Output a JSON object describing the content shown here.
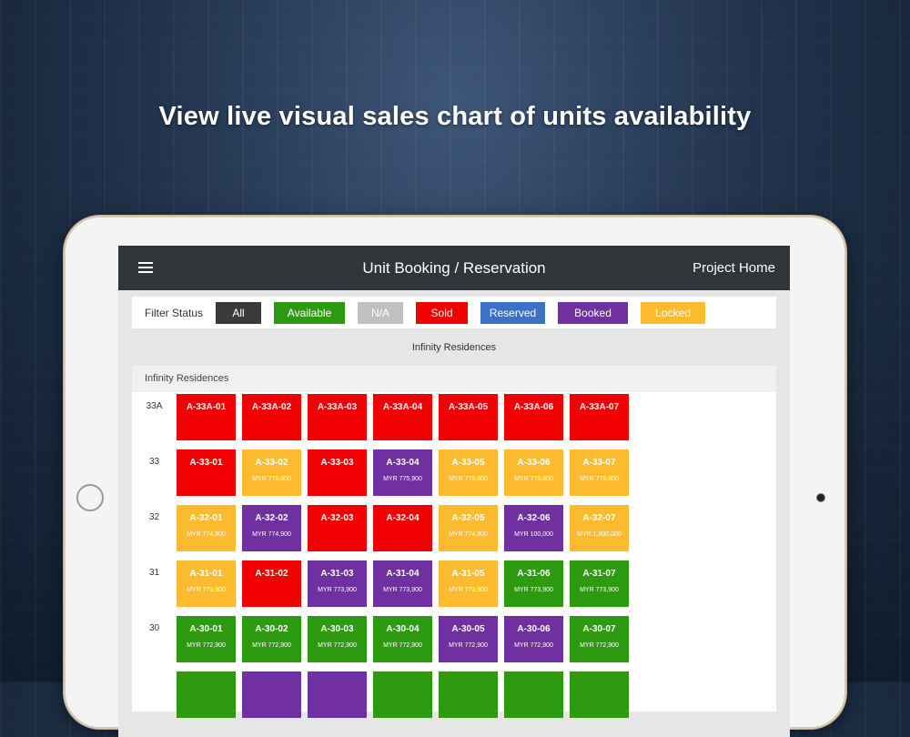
{
  "headline": "View live visual sales chart of units availability",
  "appbar": {
    "title": "Unit Booking / Reservation",
    "right_link": "Project Home"
  },
  "filter": {
    "label": "Filter Status",
    "chips": [
      {
        "label": "All",
        "color": "#3a3a3a",
        "width": 50
      },
      {
        "label": "Available",
        "color": "#2e9a12",
        "width": 78
      },
      {
        "label": "N/A",
        "color": "#c0c0c0",
        "width": 50
      },
      {
        "label": "Sold",
        "color": "#f00000",
        "width": 57
      },
      {
        "label": "Reserved",
        "color": "#3c71c6",
        "width": 71
      },
      {
        "label": "Booked",
        "color": "#7030a0",
        "width": 77
      },
      {
        "label": "Locked",
        "color": "#fdbb30",
        "width": 71
      }
    ]
  },
  "project_title": "Infinity Residences",
  "panel_title": "Infinity Residences",
  "status_colors": {
    "sold": "#f00000",
    "locked": "#fdbb30",
    "booked": "#7030a0",
    "available": "#2e9a12"
  },
  "floors": [
    {
      "floor": "33A",
      "units": [
        {
          "code": "A-33A-01",
          "status": "sold",
          "price": ""
        },
        {
          "code": "A-33A-02",
          "status": "sold",
          "price": ""
        },
        {
          "code": "A-33A-03",
          "status": "sold",
          "price": ""
        },
        {
          "code": "A-33A-04",
          "status": "sold",
          "price": ""
        },
        {
          "code": "A-33A-05",
          "status": "sold",
          "price": ""
        },
        {
          "code": "A-33A-06",
          "status": "sold",
          "price": ""
        },
        {
          "code": "A-33A-07",
          "status": "sold",
          "price": ""
        }
      ]
    },
    {
      "floor": "33",
      "units": [
        {
          "code": "A-33-01",
          "status": "sold",
          "price": ""
        },
        {
          "code": "A-33-02",
          "status": "locked",
          "price": "MYR 775,900"
        },
        {
          "code": "A-33-03",
          "status": "sold",
          "price": ""
        },
        {
          "code": "A-33-04",
          "status": "booked",
          "price": "MYR 775,900"
        },
        {
          "code": "A-33-05",
          "status": "locked",
          "price": "MYR 775,900"
        },
        {
          "code": "A-33-06",
          "status": "locked",
          "price": "MYR 775,900"
        },
        {
          "code": "A-33-07",
          "status": "locked",
          "price": "MYR 775,900"
        }
      ]
    },
    {
      "floor": "32",
      "units": [
        {
          "code": "A-32-01",
          "status": "locked",
          "price": "MYR 774,900"
        },
        {
          "code": "A-32-02",
          "status": "booked",
          "price": "MYR 774,900"
        },
        {
          "code": "A-32-03",
          "status": "sold",
          "price": ""
        },
        {
          "code": "A-32-04",
          "status": "sold",
          "price": ""
        },
        {
          "code": "A-32-05",
          "status": "locked",
          "price": "MYR 774,900"
        },
        {
          "code": "A-32-06",
          "status": "booked",
          "price": "MYR 100,000"
        },
        {
          "code": "A-32-07",
          "status": "locked",
          "price": "MYR 1,000,000"
        }
      ]
    },
    {
      "floor": "31",
      "units": [
        {
          "code": "A-31-01",
          "status": "locked",
          "price": "MYR 773,900"
        },
        {
          "code": "A-31-02",
          "status": "sold",
          "price": ""
        },
        {
          "code": "A-31-03",
          "status": "booked",
          "price": "MYR 773,900"
        },
        {
          "code": "A-31-04",
          "status": "booked",
          "price": "MYR 773,900"
        },
        {
          "code": "A-31-05",
          "status": "locked",
          "price": "MYR 773,900"
        },
        {
          "code": "A-31-06",
          "status": "available",
          "price": "MYR 773,900"
        },
        {
          "code": "A-31-07",
          "status": "available",
          "price": "MYR 773,900"
        }
      ]
    },
    {
      "floor": "30",
      "units": [
        {
          "code": "A-30-01",
          "status": "available",
          "price": "MYR 772,900"
        },
        {
          "code": "A-30-02",
          "status": "available",
          "price": "MYR 772,900"
        },
        {
          "code": "A-30-03",
          "status": "available",
          "price": "MYR 772,900"
        },
        {
          "code": "A-30-04",
          "status": "available",
          "price": "MYR 772,900"
        },
        {
          "code": "A-30-05",
          "status": "booked",
          "price": "MYR 772,900"
        },
        {
          "code": "A-30-06",
          "status": "booked",
          "price": "MYR 772,900"
        },
        {
          "code": "A-30-07",
          "status": "available",
          "price": "MYR 772,900"
        }
      ]
    },
    {
      "floor": "",
      "units": [
        {
          "code": "",
          "status": "available",
          "price": ""
        },
        {
          "code": "",
          "status": "booked",
          "price": ""
        },
        {
          "code": "",
          "status": "booked",
          "price": ""
        },
        {
          "code": "",
          "status": "available",
          "price": ""
        },
        {
          "code": "",
          "status": "available",
          "price": ""
        },
        {
          "code": "",
          "status": "available",
          "price": ""
        },
        {
          "code": "",
          "status": "available",
          "price": ""
        }
      ]
    }
  ]
}
